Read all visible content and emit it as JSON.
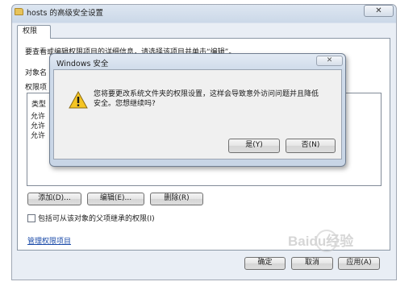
{
  "window": {
    "title": "hosts 的高级安全设置",
    "close_glyph": "✕",
    "tab_label": "权限",
    "info_text": "要查看或编辑权限项目的详细信息，请选择该项目并单击“编辑”。",
    "object_name_label": "对象名",
    "entries_label": "权限项",
    "column_type": "类型",
    "rows": [
      "允许",
      "允许",
      "允许"
    ],
    "add_button": "添加(D)...",
    "edit_button": "编辑(E)...",
    "delete_button": "删除(R)",
    "inherit_label": "包括可从该对象的父项继承的权限(I)",
    "manage_link": "管理权限项目",
    "ok_button": "确定",
    "cancel_button": "取消",
    "apply_button": "应用(A)"
  },
  "dialog": {
    "title": "Windows 安全",
    "close_glyph": "✕",
    "message_line1": "您将要更改系统文件夹的权限设置，这样会导致意外访问问题并且降低",
    "message_line2": "安全。您想继续吗?",
    "yes_button": "是(Y)",
    "no_button": "否(N)"
  },
  "watermark": {
    "text": "Baidu经验"
  },
  "colors": {
    "warning_yellow": "#f5c523",
    "link_blue": "#1a4aa8",
    "title_bar": "#cfdbea"
  },
  "icons": {
    "warning": "warning-icon",
    "folder": "folder-icon"
  }
}
